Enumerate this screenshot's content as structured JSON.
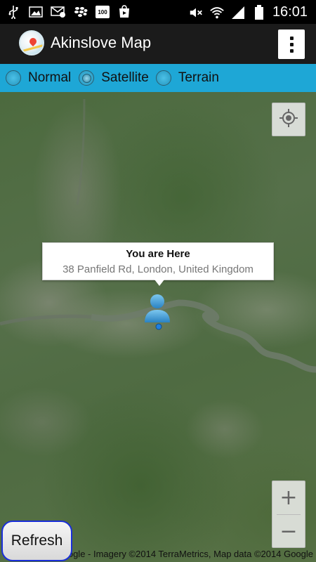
{
  "status_bar": {
    "time": "16:01",
    "battery_badge": "100",
    "left_icons": [
      "usb-icon",
      "image-icon",
      "sms-icon",
      "blackberry-icon",
      "battery-badge-icon",
      "play-store-icon"
    ],
    "right_icons": [
      "mute-icon",
      "wifi-icon",
      "signal-icon",
      "battery-icon"
    ]
  },
  "action_bar": {
    "title": "Akinslove Map",
    "overflow_icon": "overflow-menu-icon"
  },
  "map_type": {
    "options": [
      {
        "label": "Normal",
        "selected": false
      },
      {
        "label": "Satellite",
        "selected": true
      },
      {
        "label": "Terrain",
        "selected": false
      }
    ]
  },
  "map": {
    "info_window": {
      "title": "You are Here",
      "snippet": "38 Panfield Rd, London, United Kingdom"
    },
    "zoom_in_label": "+",
    "zoom_out_label": "−",
    "attribution": "©2014 Google - Imagery ©2014 TerraMetrics, Map data ©2014 Google",
    "my_location_icon": "my-location-icon",
    "marker_icon": "person-marker-icon"
  },
  "refresh_button": {
    "label": "Refresh"
  },
  "colors": {
    "radio_bar": "#1ea7d6",
    "action_bar": "#1b1b1b",
    "refresh_border": "#1a2fd9"
  }
}
